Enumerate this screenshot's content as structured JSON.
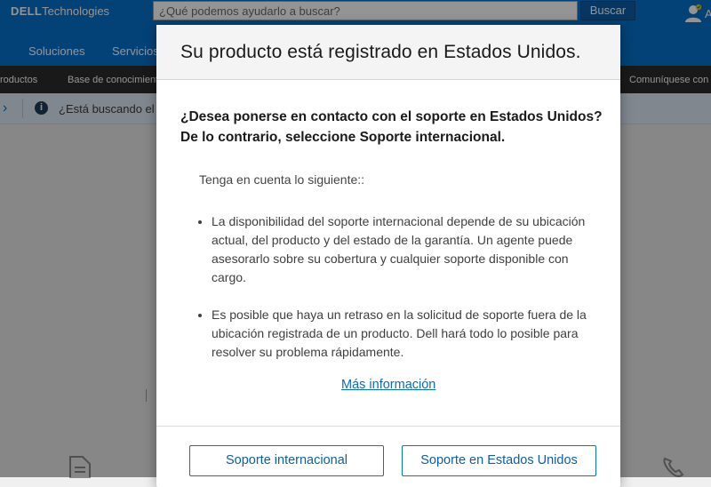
{
  "header": {
    "logo_brand": "DELL",
    "logo_suffix": "Technologies",
    "search_placeholder": "¿Qué podemos ayudarlo a buscar?",
    "search_button": "Buscar",
    "account_label": "A"
  },
  "nav": {
    "items": [
      "Soluciones",
      "Servicios"
    ]
  },
  "subnav": {
    "items": [
      "roductos",
      "Base de conocimiento",
      "Comuníquese con e"
    ]
  },
  "notice": {
    "text": "¿Está buscando el e"
  },
  "background": {
    "ghost_text": "I"
  },
  "modal": {
    "title": "Su producto está registrado en Estados Unidos.",
    "question_line1": "¿Desea ponerse en contacto con el soporte en Estados Unidos?",
    "question_line2": "De lo contrario, seleccione Soporte internacional.",
    "note": "Tenga en cuenta lo siguiente::",
    "bullet1": {
      "line1": "La disponibilidad del soporte internacional depende de su ubicación",
      "line2": "actual, del producto y del estado de la garantía. Un agente puede",
      "line3": "asesorarlo sobre su cobertura y cualquier soporte disponible con",
      "line4": "cargo."
    },
    "bullet2": {
      "line1": "Es posible que haya un retraso en la solicitud de soporte fuera de la",
      "line2": "ubicación registrada de un producto. Dell hará todo lo posible para",
      "line3": "resolver su problema rápidamente."
    },
    "more_link": "Más información",
    "btn_international": "Soporte internacional",
    "btn_us": "Soporte en Estados Unidos"
  },
  "colors": {
    "brand_blue": "#0672cb",
    "subnav_dark": "#2b2b2b",
    "link_blue": "#0b6bbf"
  }
}
